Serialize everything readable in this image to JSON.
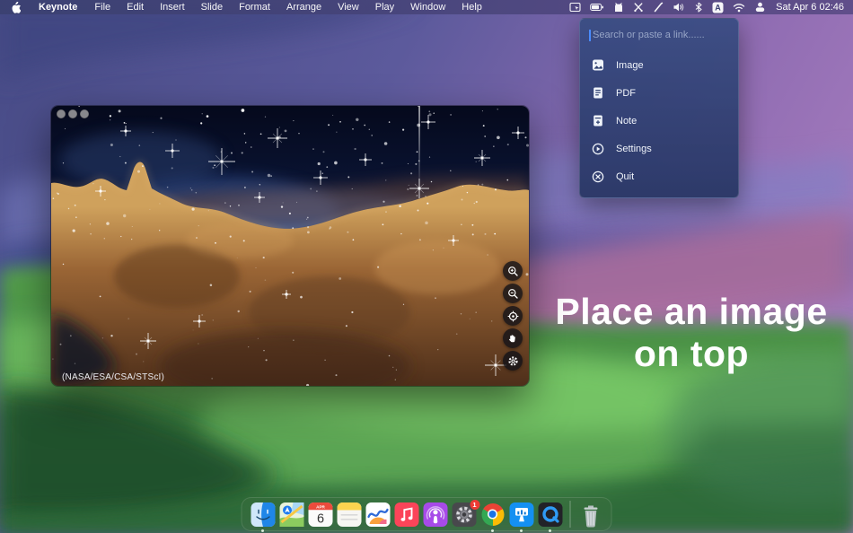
{
  "menubar": {
    "app_name": "Keynote",
    "menus": [
      "File",
      "Edit",
      "Insert",
      "Slide",
      "Format",
      "Arrange",
      "View",
      "Play",
      "Window",
      "Help"
    ],
    "status_icons": [
      "screenshot-icon",
      "battery-icon",
      "cat-icon",
      "scissors-icon",
      "wand-icon",
      "volume-icon",
      "bluetooth-icon",
      "input-source-icon",
      "wifi-icon",
      "user-switch-icon"
    ],
    "input_source_label": "A",
    "clock": "Sat Apr 6 02:46"
  },
  "dropdown_menu": {
    "search_placeholder": "Search or paste a link......",
    "items": [
      {
        "icon": "image-icon",
        "label": "Image"
      },
      {
        "icon": "pdf-icon",
        "label": "PDF"
      },
      {
        "icon": "note-icon",
        "label": "Note"
      },
      {
        "icon": "settings-icon",
        "label": "Settings"
      },
      {
        "icon": "quit-icon",
        "label": "Quit"
      }
    ]
  },
  "image_window": {
    "caption": "(NASA/ESA/CSA/STScI)",
    "controls": [
      "zoom-in-icon",
      "zoom-out-icon",
      "reset-zoom-icon",
      "pan-hand-icon",
      "gear-icon"
    ],
    "traffic_lights_state": "inactive"
  },
  "desktop": {
    "headline_line1": "Place an image",
    "headline_line2": "on top"
  },
  "dock": {
    "items": [
      "finder",
      "maps",
      "calendar",
      "notes",
      "freeform",
      "music",
      "podcasts",
      "system-settings",
      "chrome",
      "keynote",
      "quicktime",
      "trash"
    ],
    "calendar_month": "APR",
    "calendar_day": "6",
    "settings_badge": "1",
    "running_indicators": [
      "finder",
      "chrome",
      "keynote",
      "quicktime"
    ]
  },
  "colors": {
    "accent_blue": "#4a8cff",
    "panel_bg": "#38508a",
    "menubar_bg": "#3c4474",
    "headline_text": "#ffffff",
    "traffic_light_inactive": "#87878c",
    "badge_red": "#ec3b34"
  }
}
